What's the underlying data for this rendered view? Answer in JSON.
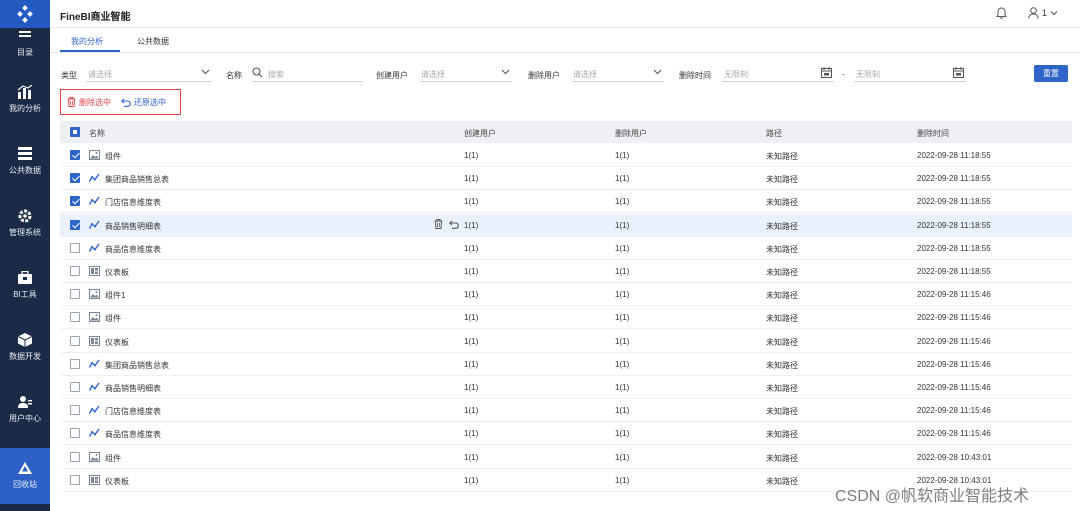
{
  "app": {
    "title": "FineBI商业智能"
  },
  "sidebar": {
    "items": [
      {
        "label": "目录",
        "icon": "catalog-icon"
      },
      {
        "label": "我的分析",
        "icon": "chart-icon"
      },
      {
        "label": "公共数据",
        "icon": "database-icon"
      },
      {
        "label": "管理系统",
        "icon": "gear-icon"
      },
      {
        "label": "BI工具",
        "icon": "toolbox-icon"
      },
      {
        "label": "数据开发",
        "icon": "cube-icon"
      },
      {
        "label": "用户中心",
        "icon": "user-group-icon"
      },
      {
        "label": "回收站",
        "icon": "recycle-icon"
      }
    ]
  },
  "header": {
    "user": "1"
  },
  "tabs": [
    {
      "label": "我的分析"
    },
    {
      "label": "公共数据"
    }
  ],
  "filters": {
    "type_label": "类型",
    "type_placeholder": "请选择",
    "name_label": "名称",
    "name_placeholder": "搜索",
    "creator_label": "创建用户",
    "creator_placeholder": "请选择",
    "deleter_label": "删除用户",
    "deleter_placeholder": "请选择",
    "time_label": "删除时间",
    "time_start": "无限制",
    "time_sep": "-",
    "time_end": "无限制",
    "reset": "重置"
  },
  "actions": {
    "delete_selected": "删除选中",
    "restore_selected": "还原选中"
  },
  "table": {
    "headers": {
      "name": "名称",
      "creator": "创建用户",
      "deleter": "删除用户",
      "path": "路径",
      "time": "删除时间"
    },
    "rows": [
      {
        "name": "组件",
        "type": "component",
        "checked": true,
        "creator": "1(1)",
        "deleter": "1(1)",
        "path": "未知路径",
        "time": "2022-09-28 11:18:55"
      },
      {
        "name": "集团商品销售总表",
        "type": "analysis",
        "checked": true,
        "creator": "1(1)",
        "deleter": "1(1)",
        "path": "未知路径",
        "time": "2022-09-28 11:18:55"
      },
      {
        "name": "门店信息维度表",
        "type": "analysis",
        "checked": true,
        "creator": "1(1)",
        "deleter": "1(1)",
        "path": "未知路径",
        "time": "2022-09-28 11:18:55"
      },
      {
        "name": "商品销售明细表",
        "type": "analysis",
        "checked": true,
        "creator": "1(1)",
        "deleter": "1(1)",
        "path": "未知路径",
        "time": "2022-09-28 11:18:55",
        "hover": true
      },
      {
        "name": "商品信息维度表",
        "type": "analysis",
        "checked": false,
        "creator": "1(1)",
        "deleter": "1(1)",
        "path": "未知路径",
        "time": "2022-09-28 11:18:55"
      },
      {
        "name": "仪表板",
        "type": "dashboard",
        "checked": false,
        "creator": "1(1)",
        "deleter": "1(1)",
        "path": "未知路径",
        "time": "2022-09-28 11:18:55"
      },
      {
        "name": "组件1",
        "type": "component",
        "checked": false,
        "creator": "1(1)",
        "deleter": "1(1)",
        "path": "未知路径",
        "time": "2022-09-28 11:15:46"
      },
      {
        "name": "组件",
        "type": "component",
        "checked": false,
        "creator": "1(1)",
        "deleter": "1(1)",
        "path": "未知路径",
        "time": "2022-09-28 11:15:46"
      },
      {
        "name": "仪表板",
        "type": "dashboard",
        "checked": false,
        "creator": "1(1)",
        "deleter": "1(1)",
        "path": "未知路径",
        "time": "2022-09-28 11:15:46"
      },
      {
        "name": "集团商品销售总表",
        "type": "analysis",
        "checked": false,
        "creator": "1(1)",
        "deleter": "1(1)",
        "path": "未知路径",
        "time": "2022-09-28 11:15:46"
      },
      {
        "name": "商品销售明细表",
        "type": "analysis",
        "checked": false,
        "creator": "1(1)",
        "deleter": "1(1)",
        "path": "未知路径",
        "time": "2022-09-28 11:15:46"
      },
      {
        "name": "门店信息维度表",
        "type": "analysis",
        "checked": false,
        "creator": "1(1)",
        "deleter": "1(1)",
        "path": "未知路径",
        "time": "2022-09-28 11:15:46"
      },
      {
        "name": "商品信息维度表",
        "type": "analysis",
        "checked": false,
        "creator": "1(1)",
        "deleter": "1(1)",
        "path": "未知路径",
        "time": "2022-09-28 11:15:46"
      },
      {
        "name": "组件",
        "type": "component",
        "checked": false,
        "creator": "1(1)",
        "deleter": "1(1)",
        "path": "未知路径",
        "time": "2022-09-28 10:43:01"
      },
      {
        "name": "仪表板",
        "type": "dashboard",
        "checked": false,
        "creator": "1(1)",
        "deleter": "1(1)",
        "path": "未知路径",
        "time": "2022-09-28 10:43:01"
      }
    ]
  },
  "watermark": "CSDN @帆软商业智能技术",
  "colors": {
    "sidebar": "#1b2a47",
    "accent": "#2f64c9",
    "danger": "#e3424b"
  }
}
